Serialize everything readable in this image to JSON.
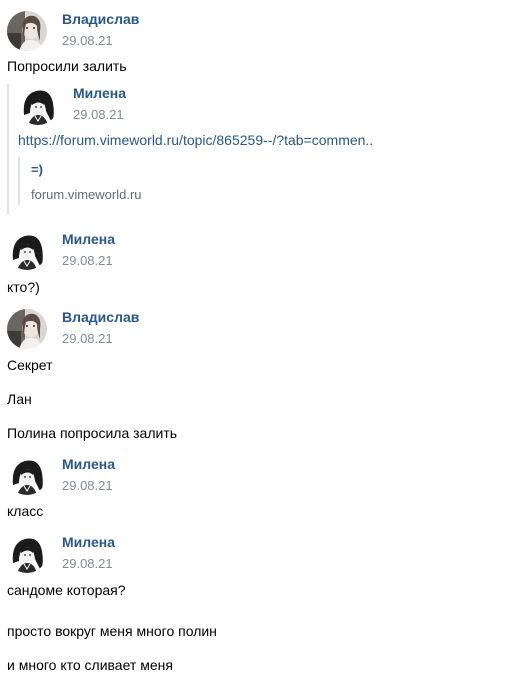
{
  "colors": {
    "author": "#2a5885",
    "date": "#818c99",
    "text": "#000000",
    "quote_bar": "#dce1e6"
  },
  "messages": [
    {
      "author": "Владислав",
      "date": "29.08.21",
      "avatar_icon": "user-photo-avatar",
      "lines": [
        "Попросили залить"
      ],
      "forwarded": {
        "author": "Милена",
        "date": "29.08.21",
        "avatar_icon": "anime-girl-avatar",
        "link": "https://forum.vimeworld.ru/topic/865259--/?tab=commen..",
        "snippet": {
          "title": "=)",
          "domain": "forum.vimeworld.ru"
        }
      }
    },
    {
      "author": "Милена",
      "date": "29.08.21",
      "avatar_icon": "anime-girl-avatar",
      "lines": [
        "кто?)"
      ]
    },
    {
      "author": "Владислав",
      "date": "29.08.21",
      "avatar_icon": "user-photo-avatar",
      "lines": [
        "Секрет",
        "Лан",
        "Полина попросила залить"
      ]
    },
    {
      "author": "Милена",
      "date": "29.08.21",
      "avatar_icon": "anime-girl-avatar",
      "lines": [
        "класс"
      ]
    },
    {
      "author": "Милена",
      "date": "29.08.21",
      "avatar_icon": "anime-girl-avatar",
      "lines": [
        "сандоме которая?",
        "просто вокруг меня много полин",
        "и много кто сливает меня"
      ]
    }
  ]
}
